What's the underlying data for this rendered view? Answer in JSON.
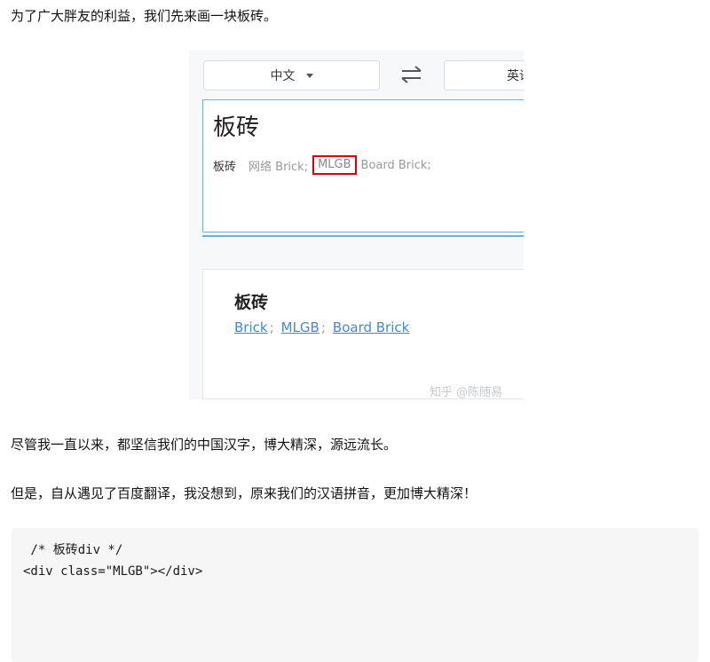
{
  "article": {
    "paragraph_1": "为了广大胖友的利益，我们先来画一块板砖。",
    "paragraph_2": "尽管我一直以来，都坚信我们的中国汉字，博大精深，源远流长。",
    "paragraph_3": "但是，自从遇见了百度翻译，我没想到，原来我们的汉语拼音，更加博大精深！"
  },
  "translator": {
    "source_lang": "中文",
    "target_lang": "英语",
    "input_text": "板砖",
    "hint_lead": "板砖",
    "hint_prefix": "网络 Brick;",
    "hint_highlight": "MLGB",
    "hint_suffix": "Board Brick;",
    "result_word": "板砖",
    "results": [
      "Brick",
      "MLGB",
      "Board Brick"
    ],
    "result_separator": ";",
    "watermark": "知乎 @陈随易"
  },
  "code": {
    "line_1": " /* 板砖div */",
    "line_2": "<div class=\"MLGB\"></div>"
  },
  "colors": {
    "highlight_border": "#d8000f",
    "link": "#4a87c8",
    "input_border": "#6fb0d8"
  }
}
